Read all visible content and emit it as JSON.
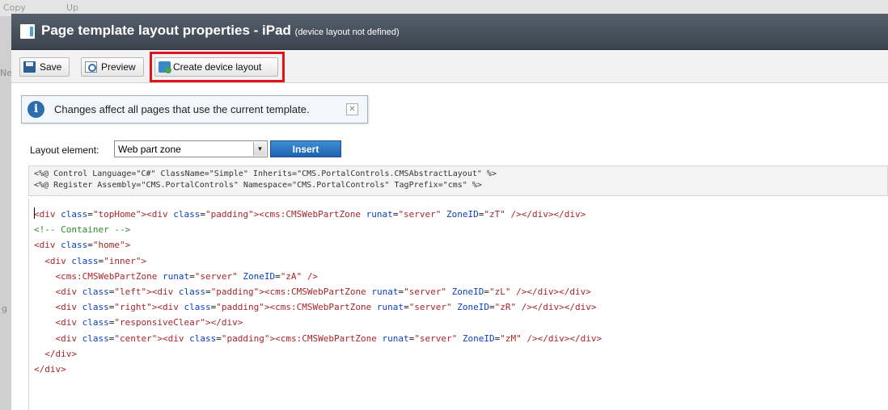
{
  "background": {
    "toolbar_items": [
      "Copy",
      "Up"
    ],
    "left_glyphs": [
      "Ne",
      "g"
    ]
  },
  "dialog": {
    "title": "Page template layout properties - iPad",
    "title_note": "(device layout not defined)"
  },
  "toolbar": {
    "save_label": "Save",
    "preview_label": "Preview",
    "create_device_layout_label": "Create device layout"
  },
  "info": {
    "message": "Changes affect all pages that use the current template.",
    "close_glyph": "✕"
  },
  "layout_element": {
    "label": "Layout element:",
    "selected": "Web part zone",
    "insert_label": "Insert"
  },
  "directives": [
    "<%@ Control Language=\"C#\" ClassName=\"Simple\" Inherits=\"CMS.PortalControls.CMSAbstractLayout\" %>",
    "<%@ Register Assembly=\"CMS.PortalControls\" Namespace=\"CMS.PortalControls\" TagPrefix=\"cms\" %>"
  ],
  "code_lines": [
    "<div class=\"topHome\"><div class=\"padding\"><cms:CMSWebPartZone runat=\"server\" ZoneID=\"zT\" /></div></div>",
    "<!-- Container -->",
    "<div class=\"home\">",
    "  <div class=\"inner\">",
    "    <cms:CMSWebPartZone runat=\"server\" ZoneID=\"zA\" />",
    "    <div class=\"left\"><div class=\"padding\"><cms:CMSWebPartZone runat=\"server\" ZoneID=\"zL\" /></div></div>",
    "    <div class=\"right\"><div class=\"padding\"><cms:CMSWebPartZone runat=\"server\" ZoneID=\"zR\" /></div></div>",
    "    <div class=\"responsiveClear\"></div>",
    "    <div class=\"center\"><div class=\"padding\"><cms:CMSWebPartZone runat=\"server\" ZoneID=\"zM\" /></div></div>",
    "  </div>",
    "</div>"
  ],
  "colors": {
    "highlight": "#e1141b",
    "title_bar": "#3b444e",
    "insert_button": "#1d62ae",
    "code_tag": "#a7252a",
    "code_attr": "#0a3fbf",
    "code_comment": "#2c8a2c"
  }
}
